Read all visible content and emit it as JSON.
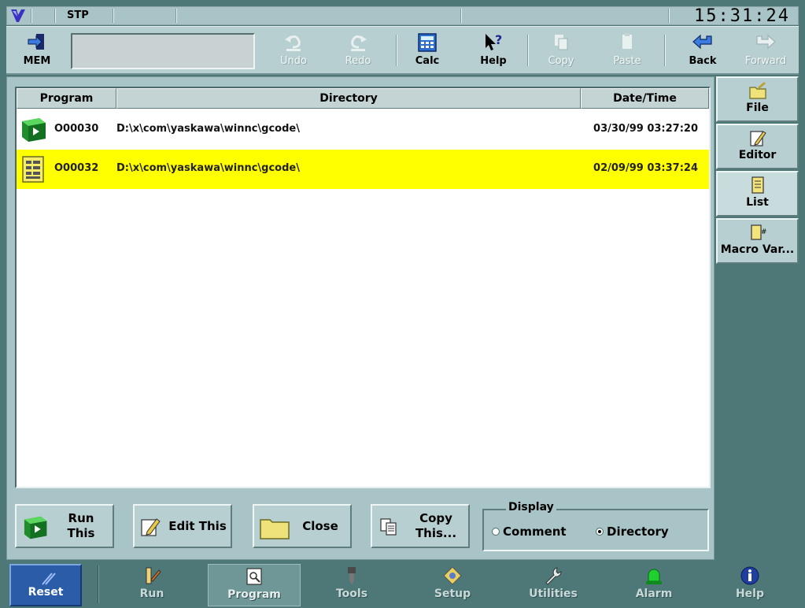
{
  "status": {
    "mode": "STP",
    "clock": "15:31:24"
  },
  "toolbar": {
    "mem_label": "MEM",
    "undo": "Undo",
    "redo": "Redo",
    "calc": "Calc",
    "help": "Help",
    "copy": "Copy",
    "paste": "Paste",
    "back": "Back",
    "forward": "Forward"
  },
  "list": {
    "columns": [
      "Program",
      "Directory",
      "Date/Time"
    ],
    "rows": [
      {
        "program": "O00030",
        "directory": "D:\\x\\com\\yaskawa\\winnc\\gcode\\",
        "datetime": "03/30/99 03:27:20",
        "selected": false
      },
      {
        "program": "O00032",
        "directory": "D:\\x\\com\\yaskawa\\winnc\\gcode\\",
        "datetime": "02/09/99 03:37:24",
        "selected": true
      }
    ]
  },
  "actions": {
    "run_this_1": "Run",
    "run_this_2": "This",
    "edit_this": "Edit This",
    "close": "Close",
    "copy_this_1": "Copy",
    "copy_this_2": "This..."
  },
  "display": {
    "legend": "Display",
    "comment": "Comment",
    "directory": "Directory",
    "selected": "directory"
  },
  "side_tabs": [
    "File",
    "Editor",
    "List",
    "Macro Var..."
  ],
  "nav": {
    "reset": "Reset",
    "items": [
      "Run",
      "Program",
      "Tools",
      "Setup",
      "Utilities",
      "Alarm",
      "Help"
    ],
    "active": "Program"
  },
  "colors": {
    "selected_row": "#ffff00",
    "panel": "#a9c4c6",
    "background": "#4e7878",
    "reset": "#2a5ca8"
  }
}
